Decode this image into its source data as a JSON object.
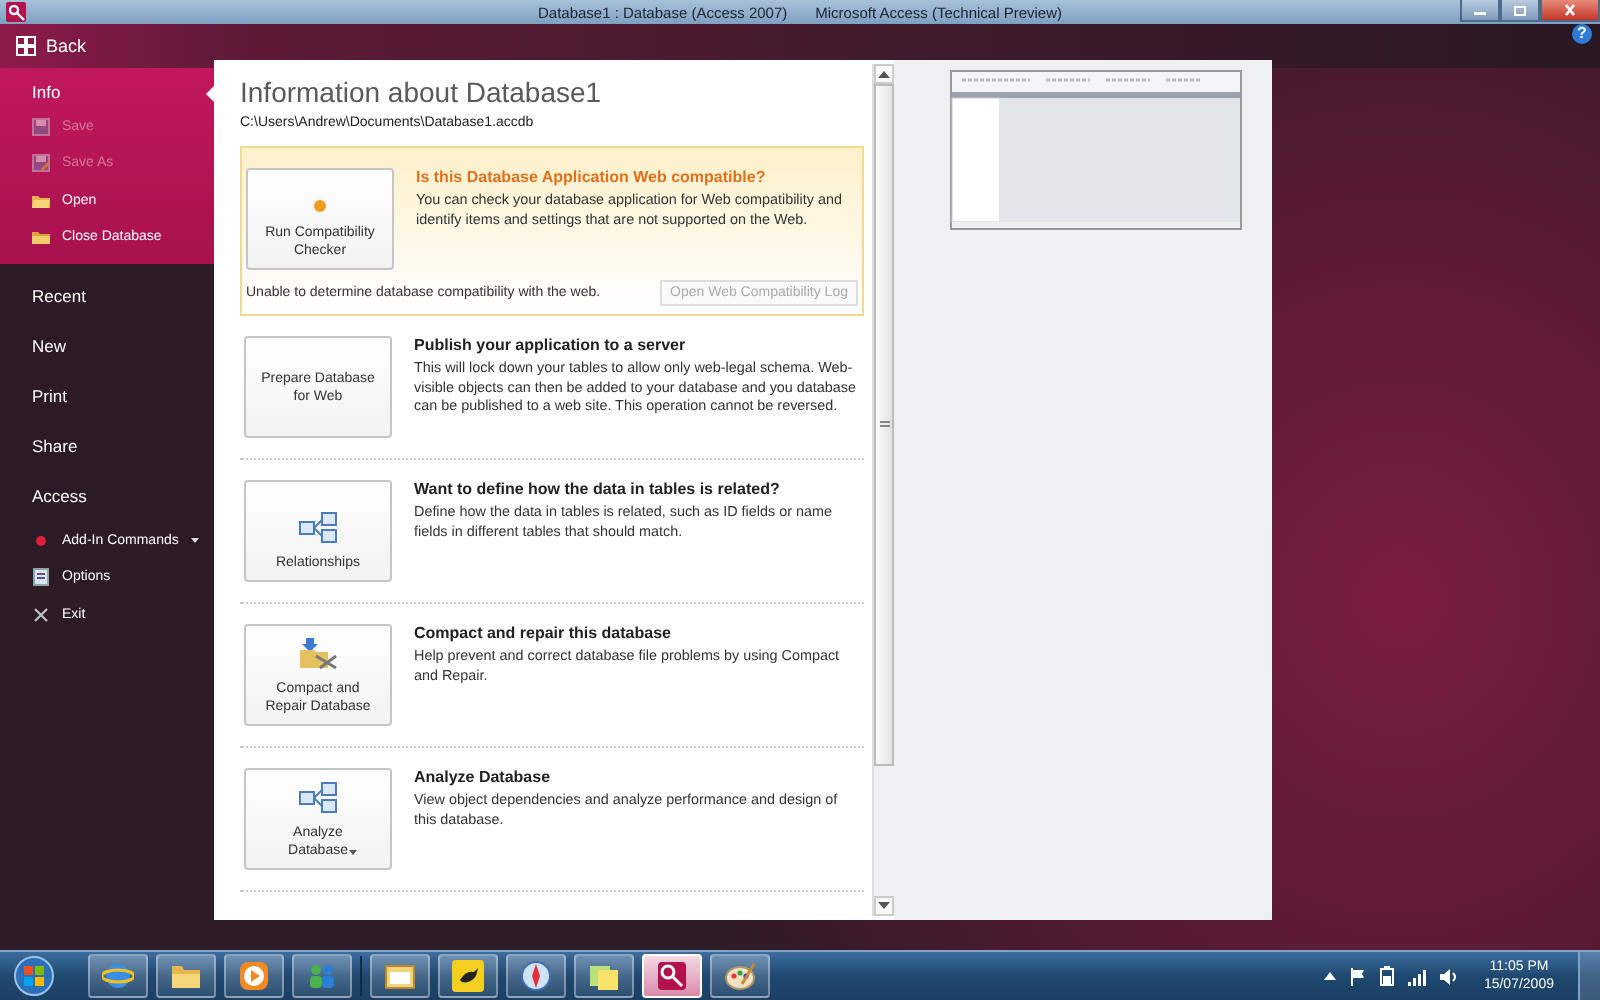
{
  "window": {
    "title": "Database1 : Database (Access 2007)",
    "app": "Microsoft Access (Technical Preview)"
  },
  "back_button": {
    "label": "Back"
  },
  "help_button": {
    "label": "?"
  },
  "sidebar": {
    "items": [
      {
        "label": "Info",
        "selected": true,
        "children": [
          {
            "label": "Save",
            "disabled": true
          },
          {
            "label": "Save As",
            "disabled": true
          },
          {
            "label": "Open",
            "disabled": false
          },
          {
            "label": "Close Database",
            "disabled": false
          }
        ]
      },
      {
        "label": "Recent",
        "selected": false
      },
      {
        "label": "New",
        "selected": false
      },
      {
        "label": "Print",
        "selected": false
      },
      {
        "label": "Share",
        "selected": false
      },
      {
        "label": "Access",
        "selected": false,
        "children": [
          {
            "label": "Add-In Commands",
            "disabled": false,
            "dropdown": true
          },
          {
            "label": "Options",
            "disabled": false
          },
          {
            "label": "Exit",
            "disabled": false
          }
        ]
      }
    ]
  },
  "info": {
    "title": "Information about Database1",
    "path": "C:\\Users\\Andrew\\Documents\\Database1.accdb",
    "sections": [
      {
        "kind": "warning",
        "button": {
          "lines": [
            "Run Compatibility",
            "Checker"
          ]
        },
        "title": "Is this Database Application Web compatible?",
        "description": "You can check your database application for Web compatibility and identify items and settings that are not supported on the Web.",
        "note": "Unable to determine database compatibility with the web.",
        "secondary_button": {
          "label": "Open Web Compatibility Log",
          "disabled": true
        }
      },
      {
        "kind": "normal",
        "button": {
          "lines": [
            "Prepare Database",
            "for Web"
          ]
        },
        "title": "Publish your application to a server",
        "description": "This will lock down your tables to allow only web-legal schema. Web-visible objects can then be added to your database and you database can be published to a web site.  This operation cannot be reversed."
      },
      {
        "kind": "normal",
        "button": {
          "lines": [
            "Relationships"
          ]
        },
        "title": "Want to define how the data in tables is related?",
        "description": "Define how the data in tables is related, such as ID fields or name fields in different tables that should match."
      },
      {
        "kind": "normal",
        "button": {
          "lines": [
            "Compact and",
            "Repair Database"
          ]
        },
        "title": "Compact and repair this database",
        "description": "Help prevent and correct database file problems by using Compact and Repair."
      },
      {
        "kind": "normal",
        "button": {
          "lines": [
            "Analyze",
            "Database"
          ],
          "dropdown": true
        },
        "title": "Analyze Database",
        "description": "View object dependencies and analyze performance and design of this database."
      }
    ]
  },
  "taskbar": {
    "buttons": [
      {
        "selected": false
      },
      {
        "selected": false
      },
      {
        "selected": false
      },
      {
        "selected": false
      },
      {
        "selected": false
      },
      {
        "selected": false
      },
      {
        "selected": false
      },
      {
        "selected": false
      },
      {
        "selected": true
      },
      {
        "selected": false
      }
    ],
    "clock": {
      "time": "11:05 PM",
      "date": "15/07/2009"
    }
  }
}
